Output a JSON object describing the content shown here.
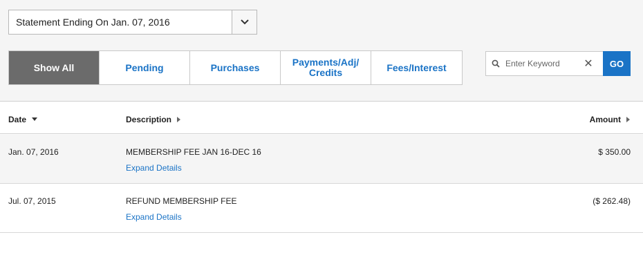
{
  "statement": {
    "selected": "Statement Ending On Jan. 07, 2016"
  },
  "tabs": [
    {
      "label": "Show All",
      "active": true
    },
    {
      "label": "Pending",
      "active": false
    },
    {
      "label": "Purchases",
      "active": false
    },
    {
      "label": "Payments/Adj/\nCredits",
      "active": false
    },
    {
      "label": "Fees/Interest",
      "active": false
    }
  ],
  "search": {
    "placeholder": "Enter Keyword",
    "go_label": "GO"
  },
  "table": {
    "headers": {
      "date": "Date",
      "description": "Description",
      "amount": "Amount"
    },
    "rows": [
      {
        "date": "Jan. 07, 2016",
        "description": "MEMBERSHIP FEE JAN 16-DEC 16",
        "link": "Expand Details",
        "amount": "$ 350.00"
      },
      {
        "date": "Jul. 07, 2015",
        "description": "REFUND MEMBERSHIP FEE",
        "link": "Expand Details",
        "amount": "($ 262.48)"
      }
    ]
  },
  "colors": {
    "accent": "#1a73c6",
    "active_tab": "#6b6b6b"
  }
}
